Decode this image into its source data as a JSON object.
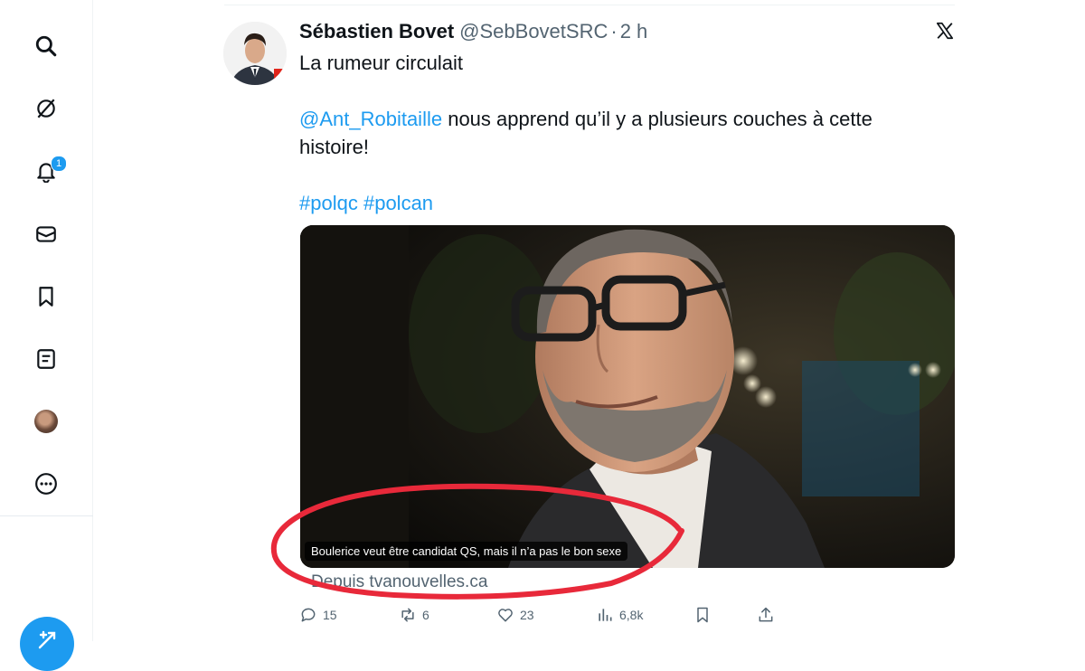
{
  "nav": {
    "items": [
      {
        "name": "search-icon"
      },
      {
        "name": "grok-icon"
      },
      {
        "name": "bell-icon",
        "badge": "1"
      },
      {
        "name": "mail-icon"
      },
      {
        "name": "bookmark-icon"
      },
      {
        "name": "list-icon"
      },
      {
        "name": "profile-avatar"
      },
      {
        "name": "more-icon"
      }
    ],
    "compose_icon": "compose-icon"
  },
  "tweet": {
    "author": "Sébastien Bovet",
    "handle": "@SebBovetSRC",
    "separator": "·",
    "time": "2 h",
    "line1": "La rumeur circulait",
    "mention": "@Ant_Robitaille",
    "line2": " nous apprend qu’il y a plusieurs couches à cette histoire!",
    "hashtag1": "#polqc",
    "hashtag2": "#polcan",
    "media_caption": "Boulerice veut être candidat QS, mais il n’a pas le bon sexe",
    "source": "Depuis tvanouvelles.ca"
  },
  "actions": {
    "replies": "15",
    "reposts": "6",
    "likes": "23",
    "views": "6,8k"
  },
  "colors": {
    "accent": "#1d9bf0",
    "muted": "#536471",
    "annotation": "#e8293a"
  }
}
